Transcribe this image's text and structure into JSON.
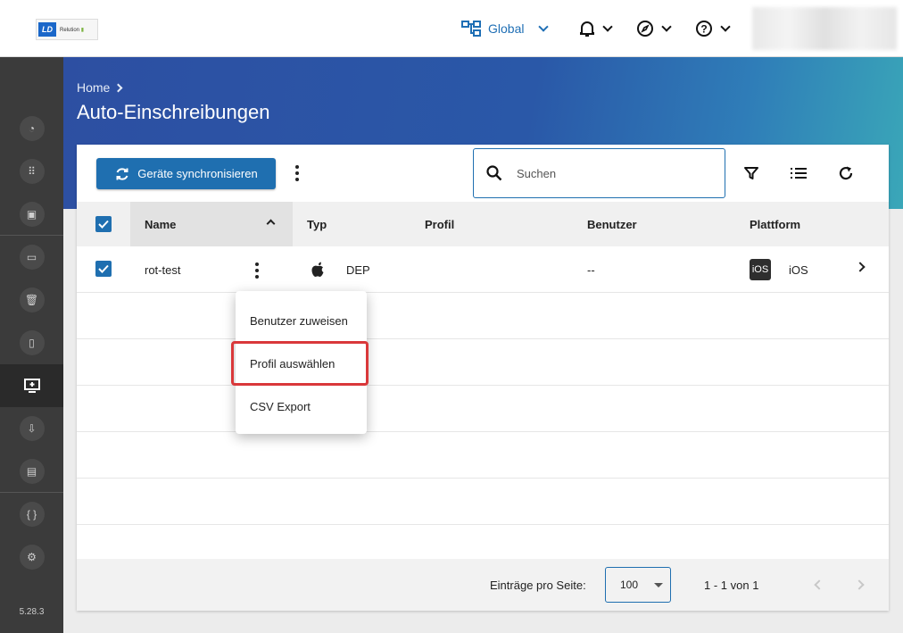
{
  "topbar": {
    "logo": {
      "mark": "LD",
      "text": "Relution"
    },
    "workspace_label": "Global",
    "icons": [
      "hierarchy-icon",
      "bell-icon",
      "compass-icon",
      "help-icon"
    ]
  },
  "sidebar": {
    "items": [
      {
        "icon": "dashboard-icon"
      },
      {
        "icon": "apps-grid-icon"
      },
      {
        "icon": "device-policy-icon"
      },
      {
        "icon": "devices-icon"
      },
      {
        "icon": "trash-icon"
      },
      {
        "icon": "mobile-devices-icon"
      },
      {
        "icon": "enrollment-icon",
        "active": true
      },
      {
        "icon": "download-device-icon"
      },
      {
        "icon": "assignment-icon"
      },
      {
        "icon": "code-icon"
      },
      {
        "icon": "user-settings-icon"
      }
    ],
    "version": "5.28.3"
  },
  "header": {
    "breadcrumb": "Home",
    "title": "Auto-Einschreibungen"
  },
  "toolbar": {
    "sync_label": "Geräte synchronisieren",
    "search_placeholder": "Suchen"
  },
  "table": {
    "columns": [
      "Name",
      "Typ",
      "Profil",
      "Benutzer",
      "Plattform"
    ],
    "rows": [
      {
        "name": "rot-test",
        "type": "DEP",
        "profile": "",
        "user": "--",
        "platform_badge": "iOS",
        "platform": "iOS",
        "checked": true
      }
    ]
  },
  "context_menu": {
    "items": [
      "Benutzer zuweisen",
      "Profil auswählen",
      "CSV Export"
    ],
    "highlighted_index": 1
  },
  "footer": {
    "per_page_label": "Einträge pro Seite:",
    "per_page_value": "100",
    "range": "1 - 1 von 1"
  },
  "colors": {
    "primary": "#1f6fb0",
    "sidebar": "#3b3b3b",
    "highlight": "#d9383a"
  }
}
